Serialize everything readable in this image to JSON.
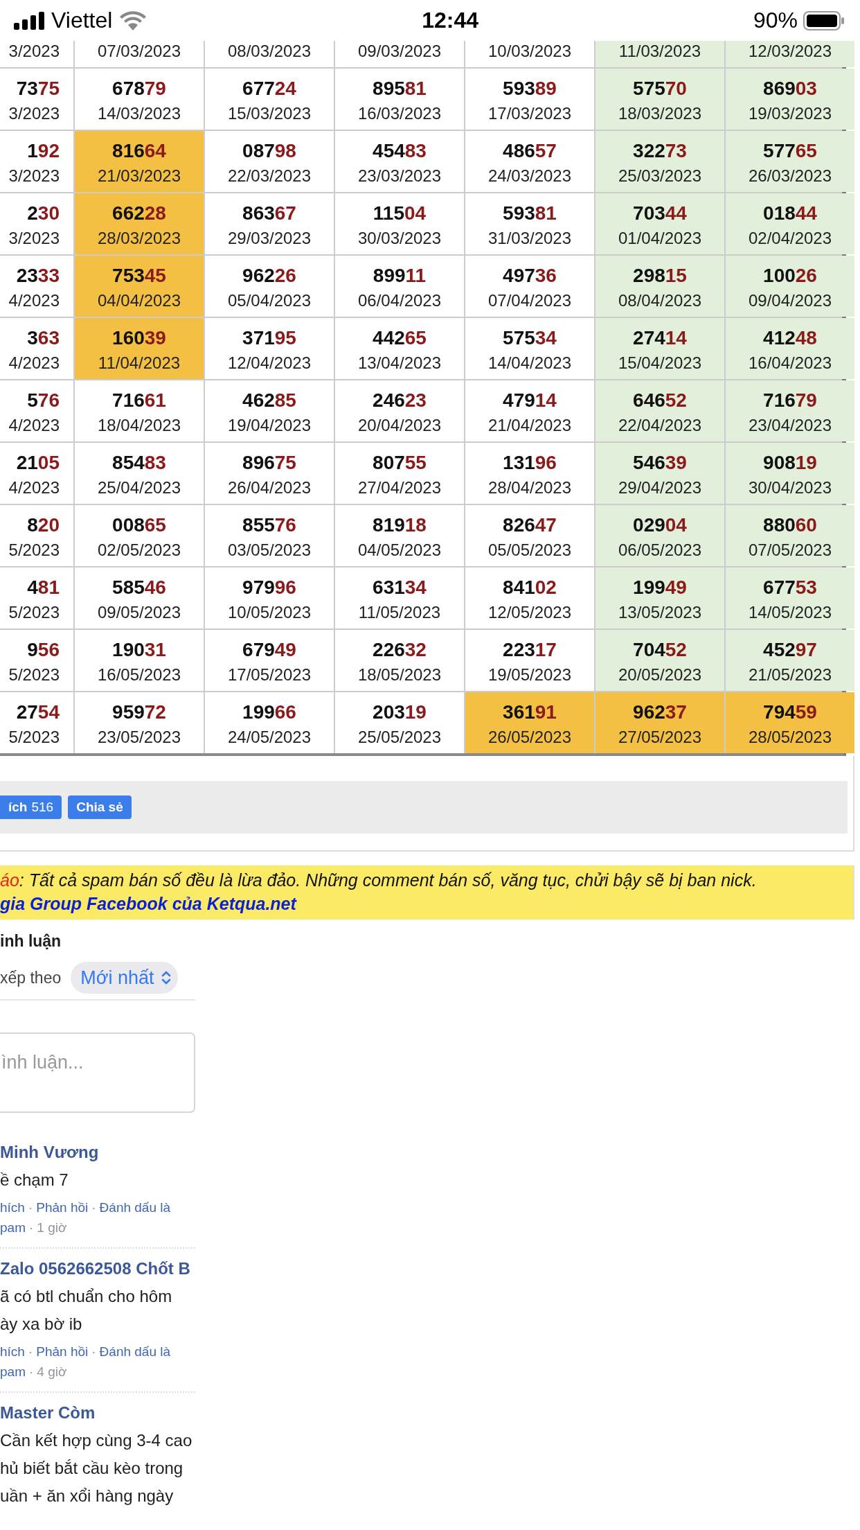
{
  "status_bar": {
    "carrier": "Viettel",
    "time": "12:44",
    "battery": "90%"
  },
  "table": {
    "rows": [
      {
        "cells": [
          {
            "date": "3/2023",
            "kind": "plain"
          },
          {
            "date": "07/03/2023",
            "kind": "plain"
          },
          {
            "date": "08/03/2023",
            "kind": "plain"
          },
          {
            "date": "09/03/2023",
            "kind": "plain"
          },
          {
            "date": "10/03/2023",
            "kind": "plain"
          },
          {
            "date": "11/03/2023",
            "kind": "weekend"
          },
          {
            "date": "12/03/2023",
            "kind": "weekend"
          }
        ]
      },
      {
        "cells": [
          {
            "head": "73",
            "tail": "75",
            "date": "3/2023",
            "kind": "plain"
          },
          {
            "head": "678",
            "tail": "79",
            "date": "14/03/2023",
            "kind": "plain"
          },
          {
            "head": "677",
            "tail": "24",
            "date": "15/03/2023",
            "kind": "plain"
          },
          {
            "head": "895",
            "tail": "81",
            "date": "16/03/2023",
            "kind": "plain"
          },
          {
            "head": "593",
            "tail": "89",
            "date": "17/03/2023",
            "kind": "plain"
          },
          {
            "head": "575",
            "tail": "70",
            "date": "18/03/2023",
            "kind": "weekend"
          },
          {
            "head": "869",
            "tail": "03",
            "date": "19/03/2023",
            "kind": "weekend"
          }
        ]
      },
      {
        "cells": [
          {
            "head": "1",
            "tail": "92",
            "date": "3/2023",
            "kind": "plain"
          },
          {
            "head": "816",
            "tail": "64",
            "date": "21/03/2023",
            "kind": "highlight"
          },
          {
            "head": "087",
            "tail": "98",
            "date": "22/03/2023",
            "kind": "plain"
          },
          {
            "head": "454",
            "tail": "83",
            "date": "23/03/2023",
            "kind": "plain"
          },
          {
            "head": "486",
            "tail": "57",
            "date": "24/03/2023",
            "kind": "plain"
          },
          {
            "head": "322",
            "tail": "73",
            "date": "25/03/2023",
            "kind": "weekend"
          },
          {
            "head": "577",
            "tail": "65",
            "date": "26/03/2023",
            "kind": "weekend"
          }
        ]
      },
      {
        "cells": [
          {
            "head": "2",
            "tail": "30",
            "date": "3/2023",
            "kind": "plain"
          },
          {
            "head": "662",
            "tail": "28",
            "date": "28/03/2023",
            "kind": "highlight"
          },
          {
            "head": "863",
            "tail": "67",
            "date": "29/03/2023",
            "kind": "plain"
          },
          {
            "head": "115",
            "tail": "04",
            "date": "30/03/2023",
            "kind": "plain"
          },
          {
            "head": "593",
            "tail": "81",
            "date": "31/03/2023",
            "kind": "plain"
          },
          {
            "head": "703",
            "tail": "44",
            "date": "01/04/2023",
            "kind": "weekend"
          },
          {
            "head": "018",
            "tail": "44",
            "date": "02/04/2023",
            "kind": "weekend"
          }
        ]
      },
      {
        "cells": [
          {
            "head": "23",
            "tail": "33",
            "date": "4/2023",
            "kind": "plain"
          },
          {
            "head": "753",
            "tail": "45",
            "date": "04/04/2023",
            "kind": "highlight"
          },
          {
            "head": "962",
            "tail": "26",
            "date": "05/04/2023",
            "kind": "plain"
          },
          {
            "head": "899",
            "tail": "11",
            "date": "06/04/2023",
            "kind": "plain"
          },
          {
            "head": "497",
            "tail": "36",
            "date": "07/04/2023",
            "kind": "plain"
          },
          {
            "head": "298",
            "tail": "15",
            "date": "08/04/2023",
            "kind": "weekend"
          },
          {
            "head": "100",
            "tail": "26",
            "date": "09/04/2023",
            "kind": "weekend"
          }
        ]
      },
      {
        "cells": [
          {
            "head": "3",
            "tail": "63",
            "date": "4/2023",
            "kind": "plain"
          },
          {
            "head": "160",
            "tail": "39",
            "date": "11/04/2023",
            "kind": "highlight"
          },
          {
            "head": "371",
            "tail": "95",
            "date": "12/04/2023",
            "kind": "plain"
          },
          {
            "head": "442",
            "tail": "65",
            "date": "13/04/2023",
            "kind": "plain"
          },
          {
            "head": "575",
            "tail": "34",
            "date": "14/04/2023",
            "kind": "plain"
          },
          {
            "head": "274",
            "tail": "14",
            "date": "15/04/2023",
            "kind": "weekend"
          },
          {
            "head": "412",
            "tail": "48",
            "date": "16/04/2023",
            "kind": "weekend"
          }
        ]
      },
      {
        "cells": [
          {
            "head": "5",
            "tail": "76",
            "date": "4/2023",
            "kind": "plain"
          },
          {
            "head": "716",
            "tail": "61",
            "date": "18/04/2023",
            "kind": "plain"
          },
          {
            "head": "462",
            "tail": "85",
            "date": "19/04/2023",
            "kind": "plain"
          },
          {
            "head": "246",
            "tail": "23",
            "date": "20/04/2023",
            "kind": "plain"
          },
          {
            "head": "479",
            "tail": "14",
            "date": "21/04/2023",
            "kind": "plain"
          },
          {
            "head": "646",
            "tail": "52",
            "date": "22/04/2023",
            "kind": "weekend"
          },
          {
            "head": "716",
            "tail": "79",
            "date": "23/04/2023",
            "kind": "weekend"
          }
        ]
      },
      {
        "cells": [
          {
            "head": "21",
            "tail": "05",
            "date": "4/2023",
            "kind": "plain"
          },
          {
            "head": "854",
            "tail": "83",
            "date": "25/04/2023",
            "kind": "plain"
          },
          {
            "head": "896",
            "tail": "75",
            "date": "26/04/2023",
            "kind": "plain"
          },
          {
            "head": "807",
            "tail": "55",
            "date": "27/04/2023",
            "kind": "plain"
          },
          {
            "head": "131",
            "tail": "96",
            "date": "28/04/2023",
            "kind": "plain"
          },
          {
            "head": "546",
            "tail": "39",
            "date": "29/04/2023",
            "kind": "weekend"
          },
          {
            "head": "908",
            "tail": "19",
            "date": "30/04/2023",
            "kind": "weekend"
          }
        ]
      },
      {
        "cells": [
          {
            "head": "8",
            "tail": "20",
            "date": "5/2023",
            "kind": "plain"
          },
          {
            "head": "008",
            "tail": "65",
            "date": "02/05/2023",
            "kind": "plain"
          },
          {
            "head": "855",
            "tail": "76",
            "date": "03/05/2023",
            "kind": "plain"
          },
          {
            "head": "819",
            "tail": "18",
            "date": "04/05/2023",
            "kind": "plain"
          },
          {
            "head": "826",
            "tail": "47",
            "date": "05/05/2023",
            "kind": "plain"
          },
          {
            "head": "029",
            "tail": "04",
            "date": "06/05/2023",
            "kind": "weekend"
          },
          {
            "head": "880",
            "tail": "60",
            "date": "07/05/2023",
            "kind": "weekend"
          }
        ]
      },
      {
        "cells": [
          {
            "head": "4",
            "tail": "81",
            "date": "5/2023",
            "kind": "plain"
          },
          {
            "head": "585",
            "tail": "46",
            "date": "09/05/2023",
            "kind": "plain"
          },
          {
            "head": "979",
            "tail": "96",
            "date": "10/05/2023",
            "kind": "plain"
          },
          {
            "head": "631",
            "tail": "34",
            "date": "11/05/2023",
            "kind": "plain"
          },
          {
            "head": "841",
            "tail": "02",
            "date": "12/05/2023",
            "kind": "plain"
          },
          {
            "head": "199",
            "tail": "49",
            "date": "13/05/2023",
            "kind": "weekend"
          },
          {
            "head": "677",
            "tail": "53",
            "date": "14/05/2023",
            "kind": "weekend"
          }
        ]
      },
      {
        "cells": [
          {
            "head": "9",
            "tail": "56",
            "date": "5/2023",
            "kind": "plain"
          },
          {
            "head": "190",
            "tail": "31",
            "date": "16/05/2023",
            "kind": "plain"
          },
          {
            "head": "679",
            "tail": "49",
            "date": "17/05/2023",
            "kind": "plain"
          },
          {
            "head": "226",
            "tail": "32",
            "date": "18/05/2023",
            "kind": "plain"
          },
          {
            "head": "223",
            "tail": "17",
            "date": "19/05/2023",
            "kind": "plain"
          },
          {
            "head": "704",
            "tail": "52",
            "date": "20/05/2023",
            "kind": "weekend"
          },
          {
            "head": "452",
            "tail": "97",
            "date": "21/05/2023",
            "kind": "weekend"
          }
        ]
      },
      {
        "cells": [
          {
            "head": "27",
            "tail": "54",
            "date": "5/2023",
            "kind": "plain"
          },
          {
            "head": "959",
            "tail": "72",
            "date": "23/05/2023",
            "kind": "plain"
          },
          {
            "head": "199",
            "tail": "66",
            "date": "24/05/2023",
            "kind": "plain"
          },
          {
            "head": "203",
            "tail": "19",
            "date": "25/05/2023",
            "kind": "plain"
          },
          {
            "head": "361",
            "tail": "91",
            "date": "26/05/2023",
            "kind": "highlight"
          },
          {
            "head": "962",
            "tail": "37",
            "date": "27/05/2023",
            "kind": "highlight"
          },
          {
            "head": "794",
            "tail": "59",
            "date": "28/05/2023",
            "kind": "highlight"
          }
        ]
      }
    ]
  },
  "share_bar": {
    "like_button": {
      "label": "ích",
      "count": "516"
    },
    "share_button": "Chia sẻ"
  },
  "notice": {
    "label": "áo",
    "text": ": Tất cả spam bán số đều là lừa đảo. Những comment bán số, văng tục, chửi bậy sẽ bị ban nick.",
    "link": "gia Group Facebook của Ketqua.net"
  },
  "comments": {
    "heading": "inh luận",
    "sort_label": "xếp theo",
    "sort_value": "Mới nhất",
    "input": {
      "placeholder": "ình luận..."
    },
    "action_separator": "·",
    "items": [
      {
        "name": "Minh Vương",
        "body": [
          "ề chạm 7"
        ],
        "action_lines": [
          [
            "hích",
            "Phản hồi",
            "Đánh dấu là"
          ],
          [
            "pam"
          ]
        ],
        "time": "1 giờ"
      },
      {
        "name": "Zalo 0562662508 Chốt B",
        "body": [
          "ã có btl chuẩn cho hôm",
          "ày xa bờ ib"
        ],
        "action_lines": [
          [
            "hích",
            "Phản hồi",
            "Đánh dấu là"
          ],
          [
            "pam"
          ]
        ],
        "time": "4 giờ"
      },
      {
        "name": "Master Còm",
        "body": [
          "Cần kết hợp cùng 3-4 cao",
          "hủ biết bắt cầu kèo trong",
          "uần + ăn xổi hàng ngày"
        ]
      }
    ]
  }
}
